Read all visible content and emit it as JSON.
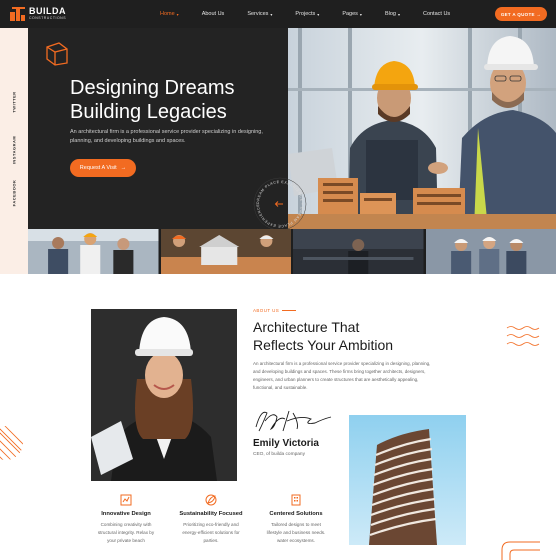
{
  "header": {
    "logo_name": "BUILDA",
    "logo_sub": "CONSTRUCTIONS",
    "nav": [
      {
        "label": "Home",
        "caret": "▾",
        "active": true
      },
      {
        "label": "About Us",
        "caret": "",
        "active": false
      },
      {
        "label": "Services",
        "caret": "▾",
        "active": false
      },
      {
        "label": "Projects",
        "caret": "▾",
        "active": false
      },
      {
        "label": "Pages",
        "caret": "▾",
        "active": false
      },
      {
        "label": "Blog",
        "caret": "▾",
        "active": false
      },
      {
        "label": "Contact Us",
        "caret": "",
        "active": false
      }
    ],
    "cta_label": "GET A QUOTE",
    "cta_arrow": "→"
  },
  "social": {
    "twitter": "TWITTER",
    "instagram": "INSTAGRAM",
    "facebook": "FACEBOOK"
  },
  "hero": {
    "title_line1": "Designing Dreams",
    "title_line2": "Building Legacies",
    "description": "An architectural firm is a professional service provider specializing in designing, planning, and developing buildings and spaces.",
    "button_label": "Request A Visit",
    "button_arrow": "→",
    "badge_text": "DREAM PLACE EXPERIENCE • DREAM PLACE EXPERIENCE •"
  },
  "about": {
    "eyebrow": "ABOUT US",
    "title_line1": "Architecture That",
    "title_line2": "Reflects Your Ambition",
    "description": "An architectural firm is a professional service provider specializing in designing, planning, and developing buildings and spaces. These firms bring together architects, designers, engineers, and urban planners to create structures that are aesthetically appealing, functional, and sustainable.",
    "person_name": "Emily Victoria",
    "person_role": "CEO, of builda company"
  },
  "features": [
    {
      "title": "Innovative Design",
      "line1": "Combining creativity with",
      "line2": "structural integrity. Relax by",
      "line3": "your private beach",
      "icon": "blueprint-icon"
    },
    {
      "title": "Sustainability Focused",
      "line1": "Prioritizing eco-friendly and",
      "line2": "energy-efficient solutions for",
      "line3": "parties.",
      "icon": "leaf-icon"
    },
    {
      "title": "Centered Solutions",
      "line1": "Tailored designs to meet",
      "line2": "lifestyle and business needs.",
      "line3": "water ecosystems.",
      "icon": "building-icon"
    }
  ],
  "colors": {
    "accent": "#f26b21",
    "dark": "#1f1f1f",
    "social_bg": "#fbeee6"
  }
}
